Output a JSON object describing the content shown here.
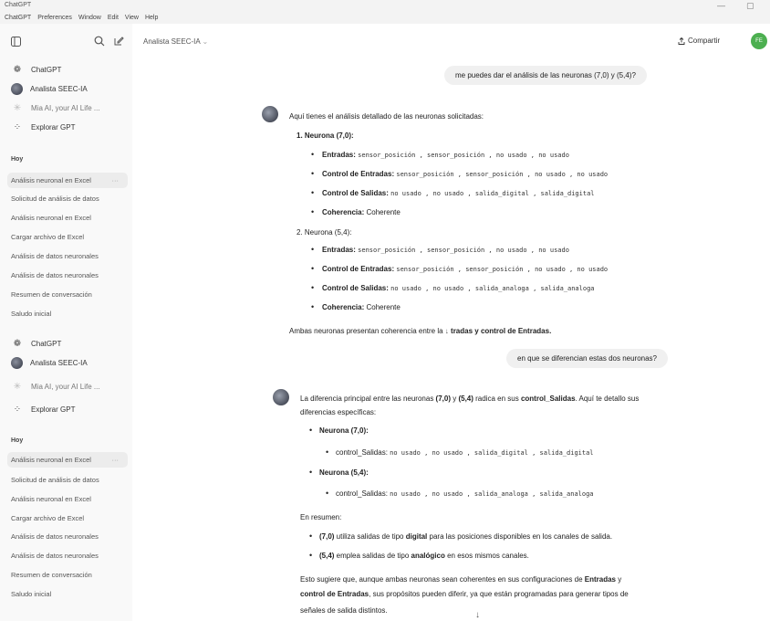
{
  "window": {
    "title": "ChatGPT",
    "minimize": "—",
    "restore": "▢"
  },
  "menu": [
    "ChatGPT",
    "Preferences",
    "Window",
    "Edit",
    "View",
    "Help"
  ],
  "sidebar": {
    "gpts_a": [
      {
        "label": "ChatGPT"
      },
      {
        "label": "Analista SEEC-IA"
      },
      {
        "label": "Mia AI, your AI Life ..."
      },
      {
        "label": "Explorar GPT"
      }
    ],
    "section_a": "Hoy",
    "history_a": [
      "Análisis neuronal en Excel",
      "Solicitud de análisis de datos",
      "Análisis neuronal en Excel",
      "Cargar archivo de Excel",
      "Análisis de datos neuronales",
      "Análisis de datos neuronales",
      "Resumen de conversación",
      "Saludo inicial"
    ],
    "gpts_b": [
      {
        "label": "ChatGPT"
      },
      {
        "label": "Analista SEEC-IA"
      },
      {
        "label": "Mia AI, your AI Life ..."
      },
      {
        "label": "Explorar GPT"
      }
    ],
    "section_b": "Hoy",
    "history_b": [
      "Análisis neuronal en Excel",
      "Solicitud de análisis de datos",
      "Análisis neuronal en Excel",
      "Cargar archivo de Excel",
      "Análisis de datos neuronales",
      "Análisis de datos neuronales",
      "Resumen de conversación",
      "Saludo inicial"
    ],
    "more": "···"
  },
  "header": {
    "model": "Analista SEEC-IA",
    "model_chevron": "⌄",
    "share": "Compartir",
    "user_initials": "FE"
  },
  "chat": {
    "q1": "me puedes dar el análisis de las neuronas (7,0) y (5,4)?",
    "a1_intro": "Aquí tienes el análisis detallado de las neuronas solicitadas:",
    "a1_n1_title": "1.  Neurona (7,0):",
    "a1_n1_in_label": "Entradas:",
    "a1_n1_in": "sensor_posición , sensor_posición , no usado , no usado",
    "a1_n1_ctrl_in_label": "Control de Entradas:",
    "a1_n1_ctrl_in": "sensor_posición , sensor_posición , no usado , no usado",
    "a1_n1_ctrl_out_label": "Control de Salidas:",
    "a1_n1_ctrl_out": "no usado , no usado , salida_digital , salida_digital",
    "a1_n1_coh_label": "Coherencia:",
    "a1_n1_coh": "Coherente",
    "a1_n2_title": "2.  Neurona (5,4):",
    "a1_n2_in_label": "Entradas:",
    "a1_n2_in": "sensor_posición , sensor_posición , no usado , no usado",
    "a1_n2_ctrl_in_label": "Control de Entradas:",
    "a1_n2_ctrl_in": "sensor_posición , sensor_posición , no usado , no usado",
    "a1_n2_ctrl_out_label": "Control de Salidas:",
    "a1_n2_ctrl_out": "no usado , no usado , salida_analoga , salida_analoga",
    "a1_n2_coh_label": "Coherencia:",
    "a1_n2_coh": "Coherente",
    "a1_outro_a": "Ambas neuronas presentan coherencia entre la",
    "a1_outro_b": "tradas y control de Entradas.",
    "q2": "en que se diferencian estas dos neuronas?",
    "a2_intro_a": "La diferencia principal entre las neuronas ",
    "a2_intro_n1": "(7,0)",
    "a2_intro_mid": " y ",
    "a2_intro_n2": "(5,4)",
    "a2_intro_b": " radica en sus ",
    "a2_intro_key": "control_Salidas",
    "a2_intro_c": ". Aquí te detallo sus",
    "a2_intro_line2": "diferencias específicas:",
    "a2_n1_title": "Neurona (7,0):",
    "a2_n1_label": "control_Salidas:",
    "a2_n1_val": "no usado , no usado , salida_digital , salida_digital",
    "a2_n2_title": "Neurona (5,4):",
    "a2_n2_label": "control_Salidas:",
    "a2_n2_val": "no usado , no usado , salida_analoga , salida_analoga",
    "a2_summary": "En resumen:",
    "a2_s1_a": "(7,0)",
    "a2_s1_b": " utiliza salidas de tipo ",
    "a2_s1_key": "digital",
    "a2_s1_c": " para las posiciones disponibles en los canales de salida.",
    "a2_s2_a": "(5,4)",
    "a2_s2_b": " emplea salidas de tipo ",
    "a2_s2_key": "analógico",
    "a2_s2_c": " en esos mismos canales.",
    "a2_end_1a": "Esto sugiere que, aunque ambas neuronas sean coherentes en sus configuraciones de ",
    "a2_end_1k": "Entradas",
    "a2_end_1b": " y",
    "a2_end_2k": "control de Entradas",
    "a2_end_2b": ", sus propósitos pueden diferir, ya que están programadas para generar tipos de",
    "a2_end_3": "señales de salida distintos."
  }
}
